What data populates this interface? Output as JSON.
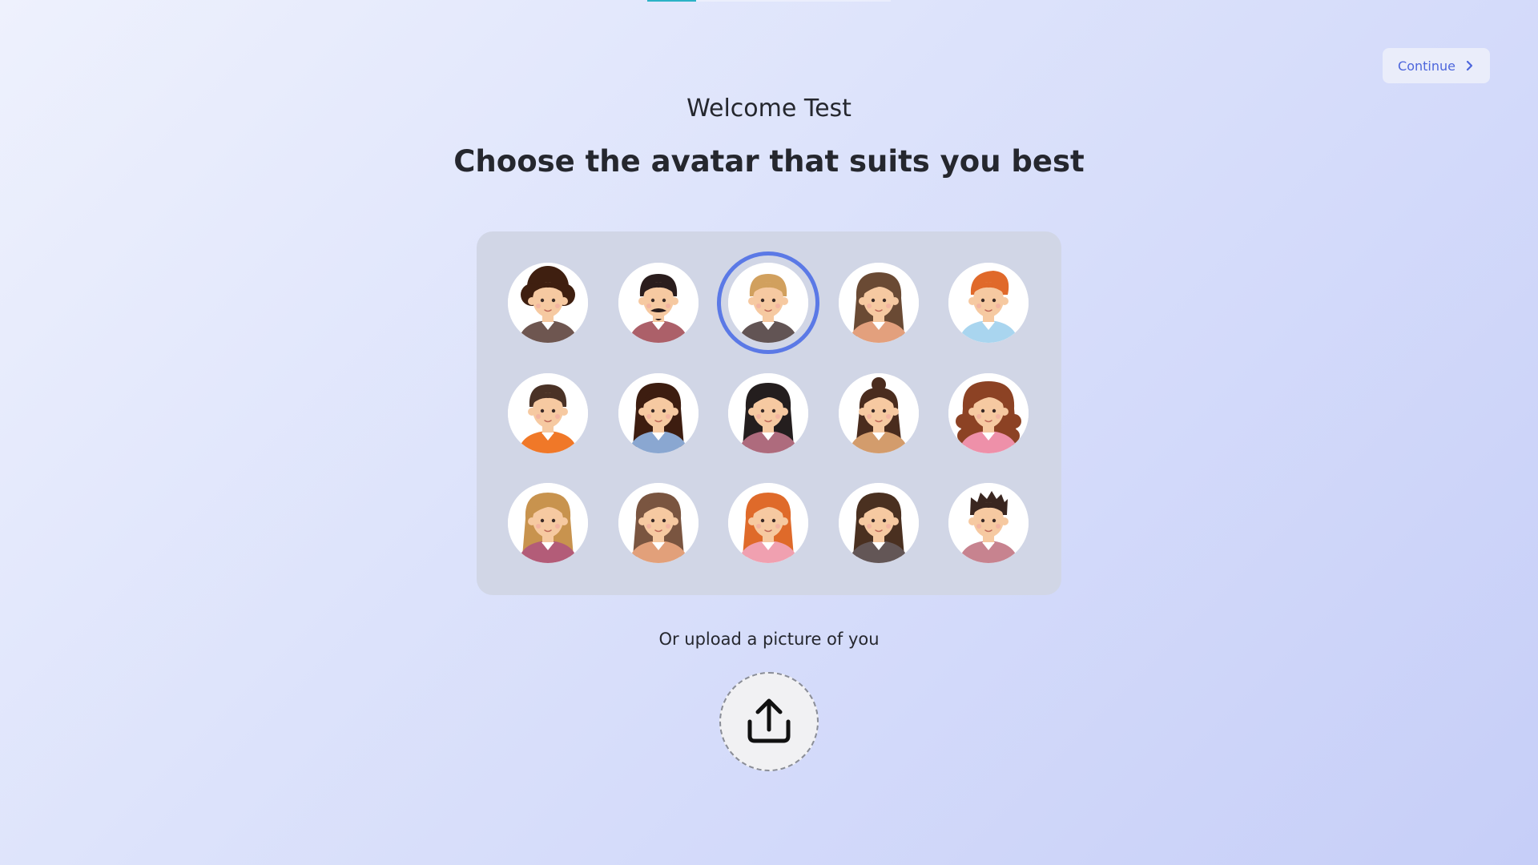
{
  "header": {
    "continue_label": "Continue",
    "continue_icon": "chevron-right-icon"
  },
  "progress": {
    "fraction": 0.2
  },
  "welcome": "Welcome Test",
  "headline": "Choose the avatar that suits you best",
  "avatars": {
    "selected_index": 2,
    "items": [
      {
        "name": "avatar-1",
        "hair": "#3f1f10",
        "style": "afro",
        "shirt": "#6e5650"
      },
      {
        "name": "avatar-2",
        "hair": "#2a1d1d",
        "style": "short-mustache",
        "shirt": "#ac6069"
      },
      {
        "name": "avatar-3",
        "hair": "#d1a05e",
        "style": "short",
        "shirt": "#625454"
      },
      {
        "name": "avatar-4",
        "hair": "#6a4a34",
        "style": "long",
        "shirt": "#e3a07d"
      },
      {
        "name": "avatar-5",
        "hair": "#e0692a",
        "style": "quiff",
        "shirt": "#a9d5ef"
      },
      {
        "name": "avatar-6",
        "hair": "#4a3226",
        "style": "short",
        "shirt": "#f07828"
      },
      {
        "name": "avatar-7",
        "hair": "#3d1d10",
        "style": "long",
        "shirt": "#8aa7d1"
      },
      {
        "name": "avatar-8",
        "hair": "#241e1e",
        "style": "long",
        "shirt": "#ae6b7d"
      },
      {
        "name": "avatar-9",
        "hair": "#4a2c1e",
        "style": "bun",
        "shirt": "#d39c6c"
      },
      {
        "name": "avatar-10",
        "hair": "#8c4224",
        "style": "curly-long",
        "shirt": "#ee90a9"
      },
      {
        "name": "avatar-11",
        "hair": "#c8934e",
        "style": "long",
        "shirt": "#b35c78"
      },
      {
        "name": "avatar-12",
        "hair": "#7a5540",
        "style": "long",
        "shirt": "#e2a07a"
      },
      {
        "name": "avatar-13",
        "hair": "#df6a2a",
        "style": "long",
        "shirt": "#f0a0b0"
      },
      {
        "name": "avatar-14",
        "hair": "#4a3020",
        "style": "long",
        "shirt": "#635656"
      },
      {
        "name": "avatar-15",
        "hair": "#3a2620",
        "style": "spiky",
        "shirt": "#c7838f"
      }
    ]
  },
  "upload": {
    "label": "Or upload a picture of you",
    "icon": "upload-icon"
  },
  "colors": {
    "accent": "#5b79e6",
    "continue_text": "#4d66dc",
    "panel": "#d1d6e6",
    "progress": "#2bb3c6",
    "skin": "#f6c9a1"
  }
}
